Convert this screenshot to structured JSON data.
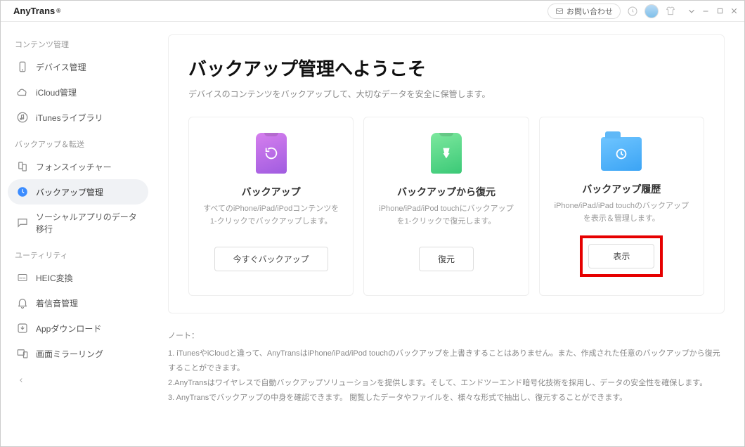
{
  "app": {
    "name": "AnyTrans",
    "reg": "®"
  },
  "titlebar": {
    "contact_label": "お問い合わせ"
  },
  "sidebar": {
    "sections": {
      "contents": "コンテンツ管理",
      "backup": "バックアップ＆転送",
      "utility": "ユーティリティ"
    },
    "items": {
      "device_mgmt": "デバイス管理",
      "icloud_mgmt": "iCloud管理",
      "itunes_lib": "iTunesライブラリ",
      "phone_switcher": "フォンスイッチャー",
      "backup_mgmt": "バックアップ管理",
      "social_migrate": "ソーシャルアプリのデータ移行",
      "heic_convert": "HEIC変換",
      "ringtone": "着信音管理",
      "app_download": "Appダウンロード",
      "screen_mirror": "画面ミラーリング"
    }
  },
  "page": {
    "title": "バックアップ管理へようこそ",
    "subtitle": "デバイスのコンテンツをバックアップして、大切なデータを安全に保管します。"
  },
  "cards": {
    "backup": {
      "title": "バックアップ",
      "desc": "すべてのiPhone/iPad/iPodコンテンツを1-クリックでバックアップします。",
      "button": "今すぐバックアップ"
    },
    "restore": {
      "title": "バックアップから復元",
      "desc": "iPhone/iPad/iPod touchにバックアップを1-クリックで復元します。",
      "button": "復元"
    },
    "history": {
      "title": "バックアップ履歴",
      "desc": "iPhone/iPad/iPad touchのバックアップを表示＆管理します。",
      "button": "表示"
    }
  },
  "notes": {
    "title": "ノート：",
    "n1": "1. iTunesやiCloudと違って、AnyTransはiPhone/iPad/iPod touchのバックアップを上書きすることはありません。また、作成された任意のバックアップから復元することができます。",
    "n2": "2.AnyTransはワイヤレスで自動バックアップソリューションを提供します。そして、エンドツーエンド暗号化技術を採用し、データの安全性を確保します。",
    "n3": "3. AnyTransでバックアップの中身を確認できます。 閲覧したデータやファイルを、様々な形式で抽出し、復元することができます。"
  }
}
